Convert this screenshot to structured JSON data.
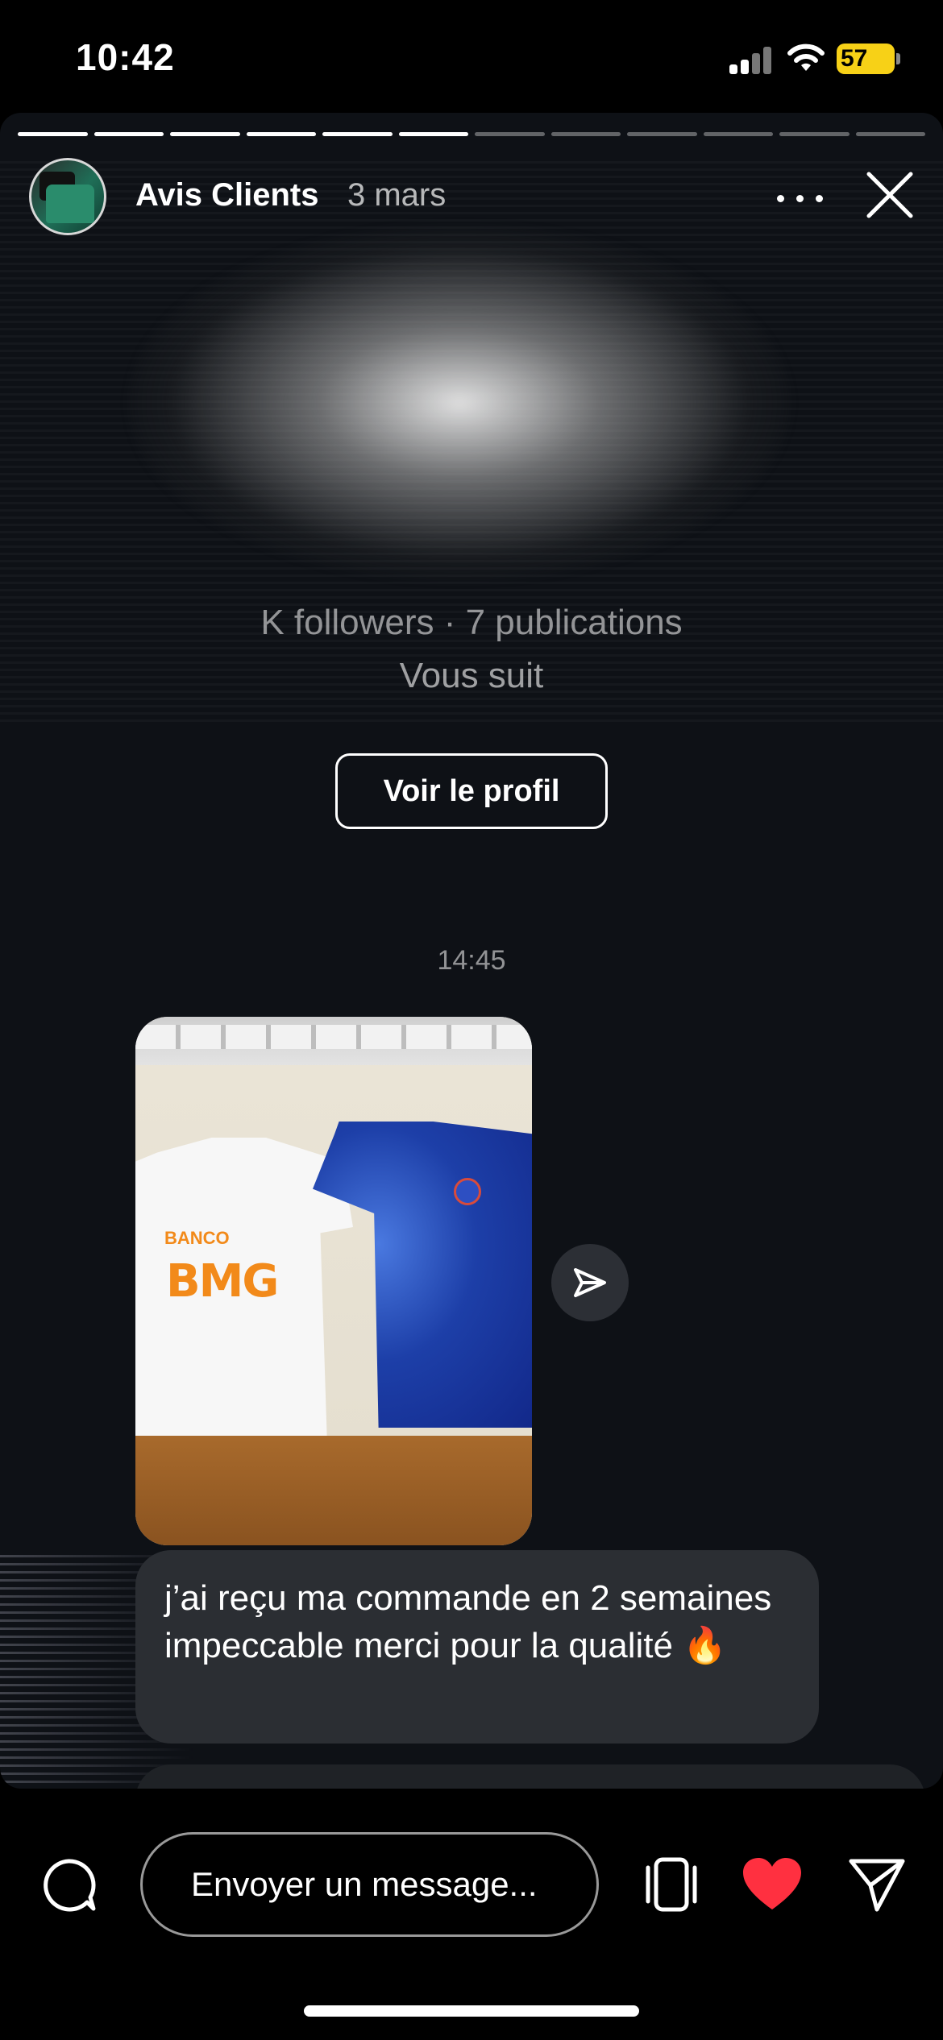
{
  "status_bar": {
    "time": "10:42",
    "battery_percent": "57"
  },
  "story": {
    "progress_segments_total": 12,
    "progress_segments_done": 6,
    "account_name": "Avis Clients",
    "post_date": "3 mars",
    "profile_stats": "K followers · 7 publications",
    "follows_you": "Vous suit",
    "view_profile_label": "Voir le profil",
    "message_time": "14:45",
    "photo_print": {
      "banco": "BANCO",
      "bmg": "BMG"
    },
    "message_text": "j’ai reçu ma commande en 2 semaines impeccable merci pour la qualité 🔥"
  },
  "bottom_bar": {
    "message_placeholder": "Envoyer un message...",
    "heart_color": "#ff3040"
  },
  "colors": {
    "battery": "#f7d117",
    "bubble": "#2b2e33",
    "story_bg": "#0e1116"
  }
}
